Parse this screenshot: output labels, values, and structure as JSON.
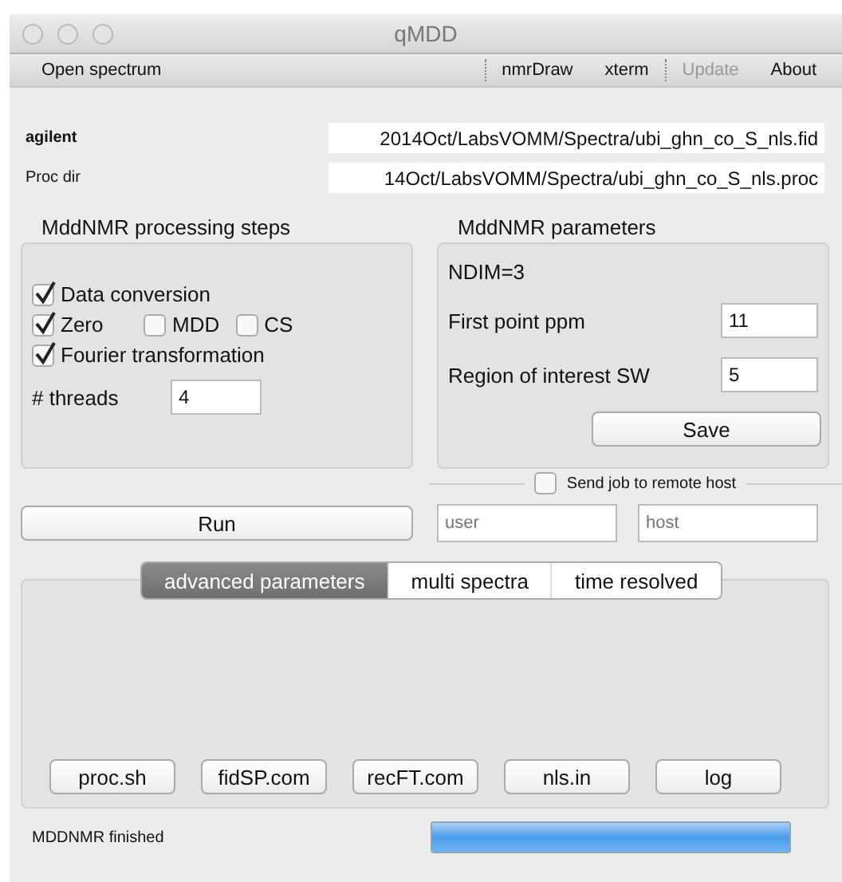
{
  "window": {
    "title": "qMDD"
  },
  "toolbar": [
    {
      "label": "Open spectrum",
      "disabled": false
    },
    {
      "label": "nmrDraw",
      "disabled": false
    },
    {
      "label": "xterm",
      "disabled": false
    },
    {
      "label": "Update",
      "disabled": true
    },
    {
      "label": "About",
      "disabled": false
    }
  ],
  "paths": [
    {
      "label": "agilent",
      "value": "2014Oct/LabsVOMM/Spectra/ubi_ghn_co_S_nls.fid"
    },
    {
      "label": "Proc dir",
      "value": "14Oct/LabsVOMM/Spectra/ubi_ghn_co_S_nls.proc"
    }
  ],
  "processing_steps": {
    "title": "MddNMR processing steps",
    "steps": [
      [
        {
          "label": "Data conversion",
          "checked": true
        }
      ],
      [
        {
          "label": "Zero",
          "checked": true
        },
        {
          "label": "MDD",
          "checked": false
        },
        {
          "label": "CS",
          "checked": false
        }
      ],
      [
        {
          "label": "Fourier transformation",
          "checked": true
        }
      ]
    ],
    "threads": {
      "label": "# threads",
      "value": "4"
    }
  },
  "parameters": {
    "title": "MddNMR parameters",
    "ndim": "NDIM=3",
    "fields": [
      {
        "label": "First point ppm",
        "value": "11"
      },
      {
        "label": "Region of interest SW",
        "value": "5"
      }
    ],
    "save": "Save"
  },
  "remote": {
    "label": "Send job to remote host",
    "checked": false,
    "user": {
      "placeholder": "user"
    },
    "host": {
      "placeholder": "host"
    }
  },
  "run": "Run",
  "tabs": [
    {
      "label": "advanced parameters",
      "selected": true
    },
    {
      "label": "multi spectra",
      "selected": false
    },
    {
      "label": "time resolved",
      "selected": false
    }
  ],
  "file_buttons": [
    "proc.sh",
    "fidSP.com",
    "recFT.com",
    "nls.in",
    "log"
  ],
  "status_bar": {
    "message": "MDDNMR finished",
    "level": 1
  }
}
